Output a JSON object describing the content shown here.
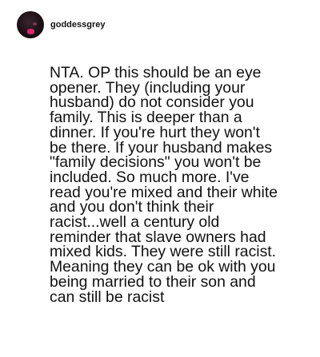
{
  "post": {
    "username": "goddessgrey",
    "avatar_icon": "user-avatar-icon",
    "body_lines": [
      "NTA. OP this should be an eye",
      "opener. They (including your",
      "husband) do not consider you",
      "family. This is deeper than a",
      "dinner. If you're hurt they won't",
      "be there. If your husband makes",
      "\"family decisions\" you won't be",
      "included. So much more. I've",
      "read you're mixed and their white",
      "and you don't think their",
      "racist...well a century old",
      "reminder that slave owners had",
      "mixed kids. They were still racist.",
      "Meaning they can be ok with you",
      "being married to their son and",
      "can still be racist"
    ]
  },
  "colors": {
    "background": "#ffffff",
    "text": "#111111",
    "avatar_accent": "#d8296b"
  }
}
